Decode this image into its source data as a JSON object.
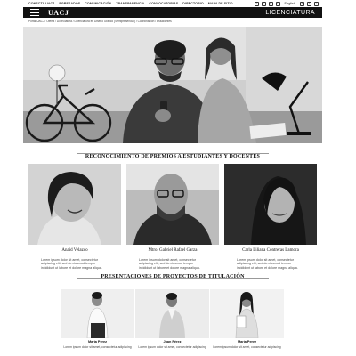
{
  "topnav": {
    "links": [
      "CONECTA UACJ",
      "EGRESADOS",
      "COMUNICACIÓN",
      "TRANSPARENCIA",
      "CONVOCATORIAS",
      "DIRECTORIO",
      "MAPA DE SITIO"
    ],
    "language": "English"
  },
  "header": {
    "logo": "UACJ",
    "section": "LICENCIATURA"
  },
  "breadcrumb": "Portal UACJ / Oferta / Licenciatura / Licenciatura en Diseño Gráfico (Semipresencial) / Coordinación / Estudiantes",
  "awards": {
    "heading": "RECONOCIMIENTO DE PREMIOS A ESTUDIANTES Y DOCENTES",
    "cards": [
      {
        "name": "Anaid Velazco",
        "desc": "Lorem ipsum dolor sit amet, consectetur adipiscing elit, sed do eiusmod tempor incididunt ut labore et dolore magna aliqua."
      },
      {
        "name": "Mtro. Gabriel Rafael Garza",
        "desc": "Lorem ipsum dolor sit amet, consectetur adipiscing elit, sed do eiusmod tempor incididunt ut labore et dolore magna aliqua."
      },
      {
        "name": "Carla Liliana Contreras Lamora",
        "desc": "Lorem ipsum dolor sit amet, consectetur adipiscing elit, sed do eiusmod tempor incididunt ut labore et dolore magna aliqua."
      }
    ]
  },
  "projects": {
    "heading": "PRESENTACIONES DE PROYECTOS DE TITULACIÓN",
    "cards": [
      {
        "name": "María Perez",
        "desc": "Lorem ipsum dolor sit amet, consectetur adipiscing"
      },
      {
        "name": "Juan Pérez",
        "desc": "Lorem ipsum dolor sit amet, consectetur adipiscing"
      },
      {
        "name": "María Perez",
        "desc": "Lorem ipsum dolor sit amet, consectetur adipiscing"
      }
    ]
  },
  "icons": {
    "social": [
      "facebook-icon",
      "twitter-icon",
      "instagram-icon",
      "youtube-icon",
      "menu-icon",
      "user-icon",
      "search-icon"
    ]
  }
}
